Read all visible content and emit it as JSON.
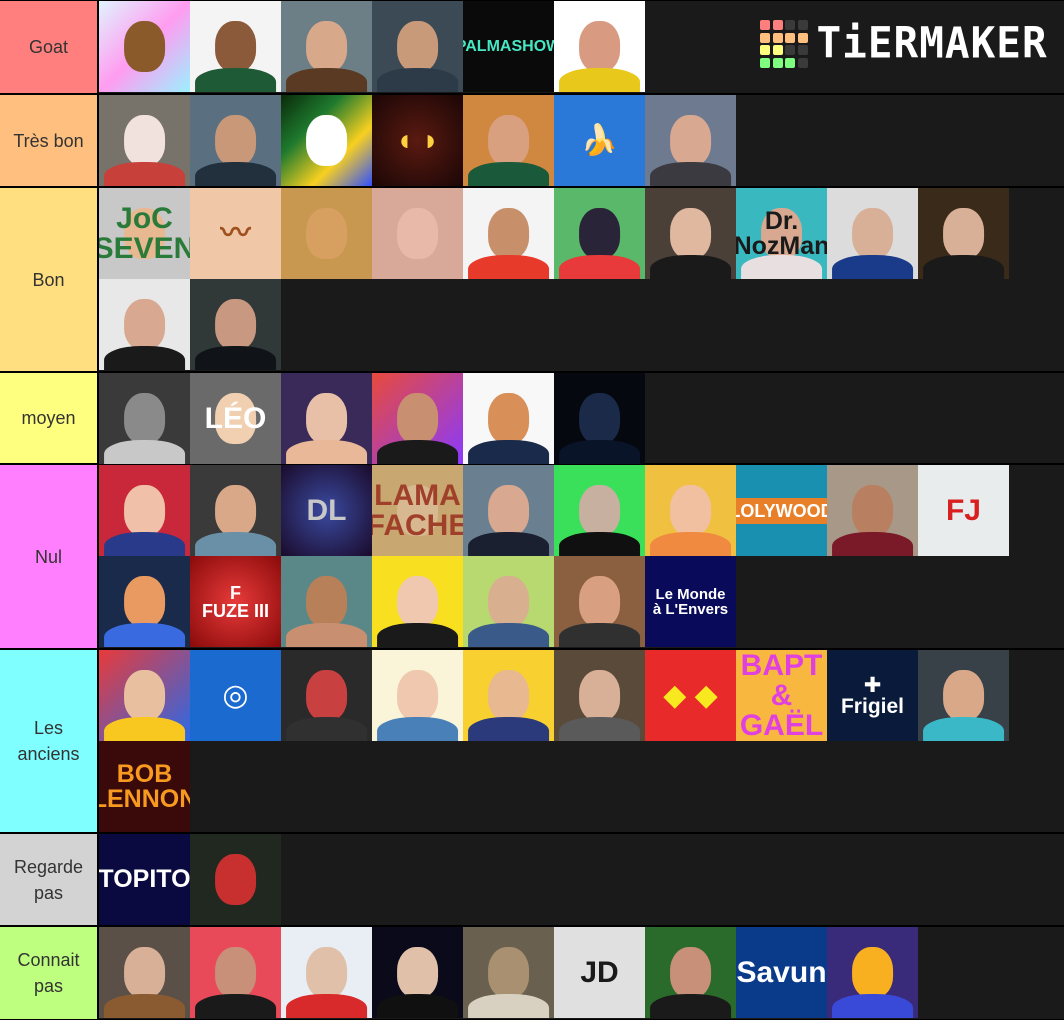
{
  "app": {
    "logo_text": "TiERMAKER",
    "logo_grid_colors": [
      "#ff7f7f",
      "#ff7f7f",
      "#3a3a3a",
      "#3a3a3a",
      "#ffbf7f",
      "#ffbf7f",
      "#ffbf7f",
      "#ffbf7f",
      "#ffff7f",
      "#ffff7f",
      "#3a3a3a",
      "#3a3a3a",
      "#7fff7f",
      "#7fff7f",
      "#7fff7f",
      "#3a3a3a"
    ]
  },
  "background_color": "#1a1a1a",
  "tiers": [
    {
      "label": "Goat",
      "color": "#ff7f7f",
      "items": [
        {
          "name": "potato-cartoon",
          "bg": "linear-gradient(135deg,#e0f4ff,#ff9cf0,#9cf0ff)",
          "face": "#8b5a2b",
          "body": "",
          "text": ""
        },
        {
          "name": "smiling-man-cap",
          "bg": "#f4f4f4",
          "face": "#8a5a3a",
          "body": "#1f5a37",
          "text": ""
        },
        {
          "name": "screaming-man-trophy",
          "bg": "#6c7e86",
          "face": "#d8a88a",
          "body": "#5a3a22",
          "text": ""
        },
        {
          "name": "curly-hair-man",
          "bg": "#3b4a55",
          "face": "#c89a7a",
          "body": "#2d3a48",
          "text": ""
        },
        {
          "name": "palmashow-logo",
          "bg": "#0a0a0a",
          "face": "",
          "body": "",
          "text": "PALMASHOW",
          "text_color": "#46e8c4"
        },
        {
          "name": "surprised-man-hawaiian",
          "bg": "#ffffff",
          "face": "#d89a80",
          "body": "#e8c81a",
          "text": ""
        }
      ]
    },
    {
      "label": "Très bon",
      "color": "#ffbf7f",
      "items": [
        {
          "name": "sketch-cat-hat",
          "bg": "#77736a",
          "face": "#f2e2de",
          "body": "#c8403a",
          "text": ""
        },
        {
          "name": "bearded-man-sea",
          "bg": "#5a7080",
          "face": "#c89878",
          "body": "#22303e",
          "text": ""
        },
        {
          "name": "white-blob-network",
          "bg": "linear-gradient(135deg,#0a2a0a,#1e7a2e,#f8d020,#3050ff)",
          "face": "#ffffff",
          "body": "",
          "text": ""
        },
        {
          "name": "fire-eyes",
          "bg": "radial-gradient(circle,#5a1a10,#1a0606)",
          "face": "",
          "body": "",
          "text": "◖ ◗",
          "text_color": "#ffd040"
        },
        {
          "name": "man-profile-glasses",
          "bg": "#d08840",
          "face": "#d9a080",
          "body": "#1a5a3a",
          "text": ""
        },
        {
          "name": "banana",
          "bg": "#2a78d8",
          "face": "",
          "body": "",
          "text": "🍌",
          "text_color": "#ffe020"
        },
        {
          "name": "young-man-portrait",
          "bg": "#6e7a90",
          "face": "#d8a890",
          "body": "#3a3a40",
          "text": ""
        }
      ]
    },
    {
      "label": "Bon",
      "color": "#ffdf7f",
      "items": [
        {
          "name": "joc-seven-logo",
          "bg": "#c8c8c8",
          "face": "#e8b890",
          "body": "",
          "text": "JoC\nSEVEN",
          "text_color": "#2a7a3a"
        },
        {
          "name": "mustache-face",
          "bg": "#f0c8a8",
          "face": "",
          "body": "",
          "text": "〰",
          "text_color": "#a0501e"
        },
        {
          "name": "sunglasses-man",
          "bg": "#c89850",
          "face": "#d8a060",
          "body": "",
          "text": ""
        },
        {
          "name": "wide-eyes-face",
          "bg": "#d8a898",
          "face": "#e8b8a8",
          "body": "",
          "text": ""
        },
        {
          "name": "two-men-red",
          "bg": "#f4f4f4",
          "face": "#c8906a",
          "body": "#e83a2a",
          "text": ""
        },
        {
          "name": "cat-sunglasses",
          "bg": "#5ab86a",
          "face": "#2a2438",
          "body": "#e83a3a",
          "text": ""
        },
        {
          "name": "man-black-shirt",
          "bg": "#4a4038",
          "face": "#e0b8a0",
          "body": "#1a1a1a",
          "text": ""
        },
        {
          "name": "dr-nozman",
          "bg": "#3ab8c0",
          "face": "#d8a890",
          "body": "#e8e0e0",
          "text": "Dr.\nNozMan",
          "text_color": "#1a1a1a"
        },
        {
          "name": "man-grey-cap",
          "bg": "#dcdcdc",
          "face": "#d8b098",
          "body": "#1a3a8a",
          "text": ""
        },
        {
          "name": "man-green-cap-mario",
          "bg": "#3a2a1a",
          "face": "#d8b098",
          "body": "#1a1a1a",
          "text": ""
        },
        {
          "name": "bearded-man-glasses",
          "bg": "#e8e8e8",
          "face": "#d8a890",
          "body": "#1a1a1a",
          "text": ""
        },
        {
          "name": "man-hoodie-dark",
          "bg": "#303838",
          "face": "#c89880",
          "body": "#101418",
          "text": ""
        }
      ]
    },
    {
      "label": "moyen",
      "color": "#ffff7f",
      "items": [
        {
          "name": "bw-man-face-hand",
          "bg": "#3a3a3a",
          "face": "#8a8a8a",
          "body": "#c8c8c8",
          "text": ""
        },
        {
          "name": "leo-cartoon",
          "bg": "#6a6a6a",
          "face": "#f0d0b0",
          "body": "",
          "text": "LÉO",
          "text_color": "#ffffff"
        },
        {
          "name": "blond-man-hand",
          "bg": "#3a2a5a",
          "face": "#e8c0a8",
          "body": "#e8b898",
          "text": ""
        },
        {
          "name": "man-waving",
          "bg": "linear-gradient(135deg,#e84a3a,#8a3aff)",
          "face": "#c89070",
          "body": "#1a1a1a",
          "text": ""
        },
        {
          "name": "monkey-cap-cartoon",
          "bg": "#f8f8f8",
          "face": "#d89058",
          "body": "#1a2a4a",
          "text": ""
        },
        {
          "name": "dark-man-blue",
          "bg": "#05080f",
          "face": "#1a2a48",
          "body": "#0a1428",
          "text": ""
        }
      ]
    },
    {
      "label": "Nul",
      "color": "#ff7fff",
      "items": [
        {
          "name": "boy-teddy-bear",
          "bg": "#c8283a",
          "face": "#f0c0a8",
          "body": "#2a3a8a",
          "text": ""
        },
        {
          "name": "bearded-man-cap",
          "bg": "#3a3a3a",
          "face": "#d8a888",
          "body": "#6a90a8",
          "text": ""
        },
        {
          "name": "dl-logo-pokemon",
          "bg": "radial-gradient(circle,#3a4aa0,#1a0a2a)",
          "face": "",
          "body": "",
          "text": "DL",
          "text_color": "#c8c8c8"
        },
        {
          "name": "lama-fache",
          "bg": "#c8a870",
          "face": "#d8b890",
          "body": "",
          "text": "LAMA\nFACHE",
          "text_color": "#a0402a"
        },
        {
          "name": "man-lake",
          "bg": "#6a8090",
          "face": "#d8a890",
          "body": "#1a2030",
          "text": ""
        },
        {
          "name": "tattooed-face-man",
          "bg": "#3ae05a",
          "face": "#c8b0a0",
          "body": "#101010",
          "text": ""
        },
        {
          "name": "two-kids-smiling",
          "bg": "#f0c040",
          "face": "#f0c0a0",
          "body": "#f08a40",
          "text": ""
        },
        {
          "name": "lolywood-logo",
          "bg": "#1a90b0",
          "face": "",
          "body": "",
          "text": "LOLYWOOD",
          "text_color": "#ffffff",
          "text_bg": "#e8802a"
        },
        {
          "name": "man-red-sweater",
          "bg": "#a89888",
          "face": "#b88060",
          "body": "#7a1a28",
          "text": ""
        },
        {
          "name": "fj-logo",
          "bg": "#e8ecec",
          "face": "",
          "body": "",
          "text": "FJ",
          "text_color": "#d82020"
        },
        {
          "name": "cartoon-boy-creature",
          "bg": "#1a2a4a",
          "face": "#e89a60",
          "body": "#3a6ae0",
          "text": ""
        },
        {
          "name": "fuze-iii-logo",
          "bg": "radial-gradient(circle,#e83a3a,#8a0a0a)",
          "face": "",
          "body": "",
          "text": "F\nFUZE III",
          "text_color": "#ffffff"
        },
        {
          "name": "shirtless-man",
          "bg": "#5a8888",
          "face": "#b88058",
          "body": "#c89070",
          "text": ""
        },
        {
          "name": "man-yellow-bg",
          "bg": "#f8e020",
          "face": "#f0c8b0",
          "body": "#1a1a1a",
          "text": ""
        },
        {
          "name": "two-men-glasses",
          "bg": "#b8d870",
          "face": "#d8b090",
          "body": "#3a5a8a",
          "text": ""
        },
        {
          "name": "man-outdoor",
          "bg": "#8a6040",
          "face": "#d8a080",
          "body": "#303030",
          "text": ""
        },
        {
          "name": "le-monde-a-lenvers",
          "bg": "#0a0a5a",
          "face": "",
          "body": "",
          "text": "Le Monde\nà L'Envers",
          "text_color": "#ffffff"
        }
      ]
    },
    {
      "label": "Les anciens",
      "color": "#7fffff",
      "items": [
        {
          "name": "curly-man-comic-bg",
          "bg": "linear-gradient(135deg,#e83a3a,#2a6ae8)",
          "face": "#e8c0a0",
          "body": "#f8c820",
          "text": ""
        },
        {
          "name": "blue-circle-logo",
          "bg": "#1a6ad0",
          "face": "",
          "body": "",
          "text": "◎",
          "text_color": "#ffffff"
        },
        {
          "name": "angry-cartoon-man-lightning",
          "bg": "#2a2a2a",
          "face": "#c84040",
          "body": "#303030",
          "text": ""
        },
        {
          "name": "woman-denim-shirt",
          "bg": "#faf4d8",
          "face": "#f0c8b0",
          "body": "#4a80b8",
          "text": ""
        },
        {
          "name": "laughing-man-stripes",
          "bg": "#f8d030",
          "face": "#e8b890",
          "body": "#2a3a7a",
          "text": ""
        },
        {
          "name": "man-arms-crossed",
          "bg": "#5a4a3a",
          "face": "#d8b098",
          "body": "#5a5a5a",
          "text": ""
        },
        {
          "name": "red-angry-face",
          "bg": "#e82a2a",
          "face": "",
          "body": "",
          "text": "◆ ◆",
          "text_color": "#f8e820"
        },
        {
          "name": "bapt-gael-logo",
          "bg": "#f8b840",
          "face": "",
          "body": "",
          "text": "BAPT\n&\nGAËL",
          "text_color": "#e040e0"
        },
        {
          "name": "frigiel-logo",
          "bg": "#0a1a3a",
          "face": "",
          "body": "",
          "text": "✚\nFrigiel",
          "text_color": "#ffffff"
        },
        {
          "name": "smiling-man-poker",
          "bg": "#384048",
          "face": "#d8a888",
          "body": "#3ab8c8",
          "text": ""
        },
        {
          "name": "bob-lennon-logo",
          "bg": "#3a0a0a",
          "face": "",
          "body": "",
          "text": "BOB\nLENNON",
          "text_color": "#f89a20"
        }
      ]
    },
    {
      "label": "Regarde pas",
      "color": "#d3d3d3",
      "items": [
        {
          "name": "topito-logo",
          "bg": "#0a0a40",
          "face": "",
          "body": "",
          "text": "TOPITO",
          "text_color": "#ffffff"
        },
        {
          "name": "red-dino-cartoon",
          "bg": "#202820",
          "face": "#c83030",
          "body": "",
          "text": ""
        }
      ]
    },
    {
      "label": "Connait pas",
      "color": "#bfff7f",
      "items": [
        {
          "name": "curly-man-brown-jacket",
          "bg": "#5a5048",
          "face": "#d8b098",
          "body": "#8a5a30",
          "text": ""
        },
        {
          "name": "man-glasses-red-bg",
          "bg": "#e84a5a",
          "face": "#c89078",
          "body": "#1a1a1a",
          "text": ""
        },
        {
          "name": "man-glasses-thinking",
          "bg": "#e8eef4",
          "face": "#e0c0a8",
          "body": "#d82a2a",
          "text": ""
        },
        {
          "name": "man-dark-bg",
          "bg": "#0a0a1a",
          "face": "#e0c0a8",
          "body": "#101010",
          "text": ""
        },
        {
          "name": "grumpy-cat",
          "bg": "#6a6050",
          "face": "#a89070",
          "body": "#d8d0c0",
          "text": ""
        },
        {
          "name": "jd-logo",
          "bg": "#e0e0e0",
          "face": "",
          "body": "",
          "text": "JD",
          "text_color": "#1a1a1a"
        },
        {
          "name": "man-big-glasses",
          "bg": "#2a6a2a",
          "face": "#c89078",
          "body": "#1a1a1a",
          "text": ""
        },
        {
          "name": "savun-logo",
          "bg": "#0a3a8a",
          "face": "",
          "body": "",
          "text": "Savun",
          "text_color": "#ffffff"
        },
        {
          "name": "minecraft-character",
          "bg": "#3a2a7a",
          "face": "#f8b020",
          "body": "#3a4ad8",
          "text": ""
        }
      ]
    }
  ]
}
